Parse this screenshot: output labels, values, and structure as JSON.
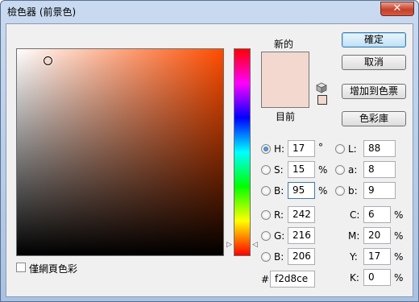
{
  "window": {
    "title": "檢色器 (前景色)",
    "close_label": "✕"
  },
  "colors": {
    "current": "#f2d8ce",
    "new": "#f2d8ce",
    "hue_base": "#ff4c00",
    "small_swatch": "#f2d8ce"
  },
  "swatch": {
    "new_label": "新的",
    "current_label": "目前"
  },
  "buttons": {
    "ok": "確定",
    "cancel": "取消",
    "add_to_swatches": "增加到色票",
    "color_libraries": "色彩庫"
  },
  "hsb": {
    "h": {
      "label": "H:",
      "value": "17",
      "unit": "°",
      "checked": true
    },
    "s": {
      "label": "S:",
      "value": "15",
      "unit": "%"
    },
    "b": {
      "label": "B:",
      "value": "95",
      "unit": "%"
    }
  },
  "rgb": {
    "r": {
      "label": "R:",
      "value": "242"
    },
    "g": {
      "label": "G:",
      "value": "216"
    },
    "b": {
      "label": "B:",
      "value": "206"
    }
  },
  "lab": {
    "l": {
      "label": "L:",
      "value": "88"
    },
    "a": {
      "label": "a:",
      "value": "8"
    },
    "b": {
      "label": "b:",
      "value": "9"
    }
  },
  "cmyk": {
    "c": {
      "label": "C:",
      "value": "6",
      "unit": "%"
    },
    "m": {
      "label": "M:",
      "value": "20",
      "unit": "%"
    },
    "y": {
      "label": "Y:",
      "value": "17",
      "unit": "%"
    },
    "k": {
      "label": "K:",
      "value": "0",
      "unit": "%"
    }
  },
  "hex": {
    "label": "#",
    "value": "f2d8ce"
  },
  "web_only": {
    "label": "僅網頁色彩",
    "checked": false
  }
}
